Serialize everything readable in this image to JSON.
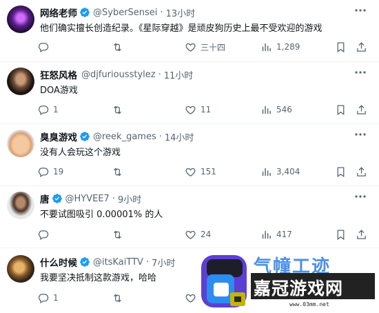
{
  "tweets": [
    {
      "name": "网络老师",
      "verified": true,
      "handle": "@SyberSensei",
      "time": "13小时",
      "text": "他们确实擅长创造纪录。《星际穿越》是顽皮狗历史上最不受欢迎的游戏",
      "replies": "",
      "reposts": "",
      "likes": "三十四",
      "views": "1,289"
    },
    {
      "name": "狂怒风格",
      "verified": false,
      "handle": "@djfuriousstylez",
      "time": "11小时",
      "text": "DOA游戏",
      "replies": "1",
      "reposts": "",
      "likes": "11",
      "views": "546"
    },
    {
      "name": "臭臭游戏",
      "verified": true,
      "handle": "@reek_games",
      "time": "14小时",
      "text": "没有人会玩这个游戏",
      "replies": "19",
      "reposts": "",
      "likes": "151",
      "views": "3,404"
    },
    {
      "name": "唐",
      "verified": true,
      "handle": "@HYVEE7",
      "time": "9小时",
      "text": "不要试图吸引 0.00001% 的人",
      "replies": "",
      "reposts": "",
      "likes": "24",
      "views": "417"
    },
    {
      "name": "什么时候",
      "verified": true,
      "handle": "@itsKaiTTV",
      "time": "7小时",
      "text": "我要坚决抵制这款游戏，哈哈",
      "replies": "1",
      "reposts": "",
      "likes": "",
      "views": ""
    }
  ],
  "watermark": {
    "title": "气幢工迹",
    "sub": "嘉冠游戏网",
    "url": "www.03mm.net"
  },
  "colors": {
    "verified": "#1d9bf0",
    "muted": "#536471",
    "text": "#0f1419"
  }
}
